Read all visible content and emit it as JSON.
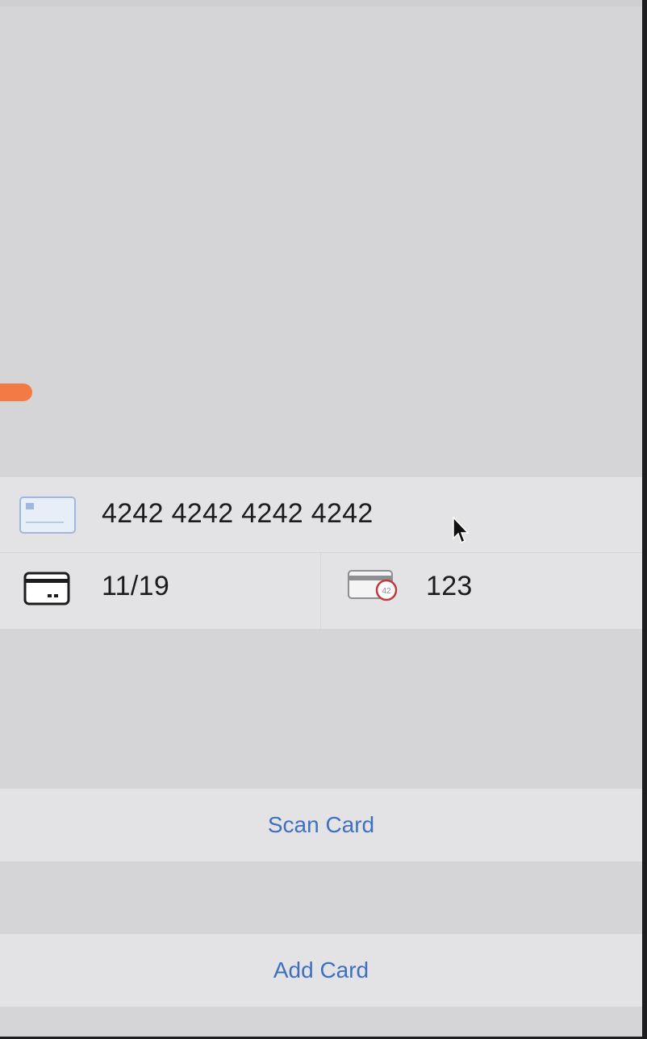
{
  "card_form": {
    "number": "4242 4242 4242 4242",
    "expiry": "11/19",
    "cvc": "123",
    "cvc_icon_badge": "42"
  },
  "icons": {
    "card_number": "credit-card-icon",
    "expiry": "card-expiry-icon",
    "cvc": "card-cvc-icon",
    "pointer": "mouse-pointer-icon"
  },
  "actions": {
    "scan_card_label": "Scan Card",
    "add_card_label": "Add Card"
  },
  "colors": {
    "background": "#d5d5d8",
    "panel": "#e3e3e5",
    "accent_link": "#3f6fbf",
    "orange_indicator": "#f47a45",
    "text": "#1c1c1e"
  }
}
